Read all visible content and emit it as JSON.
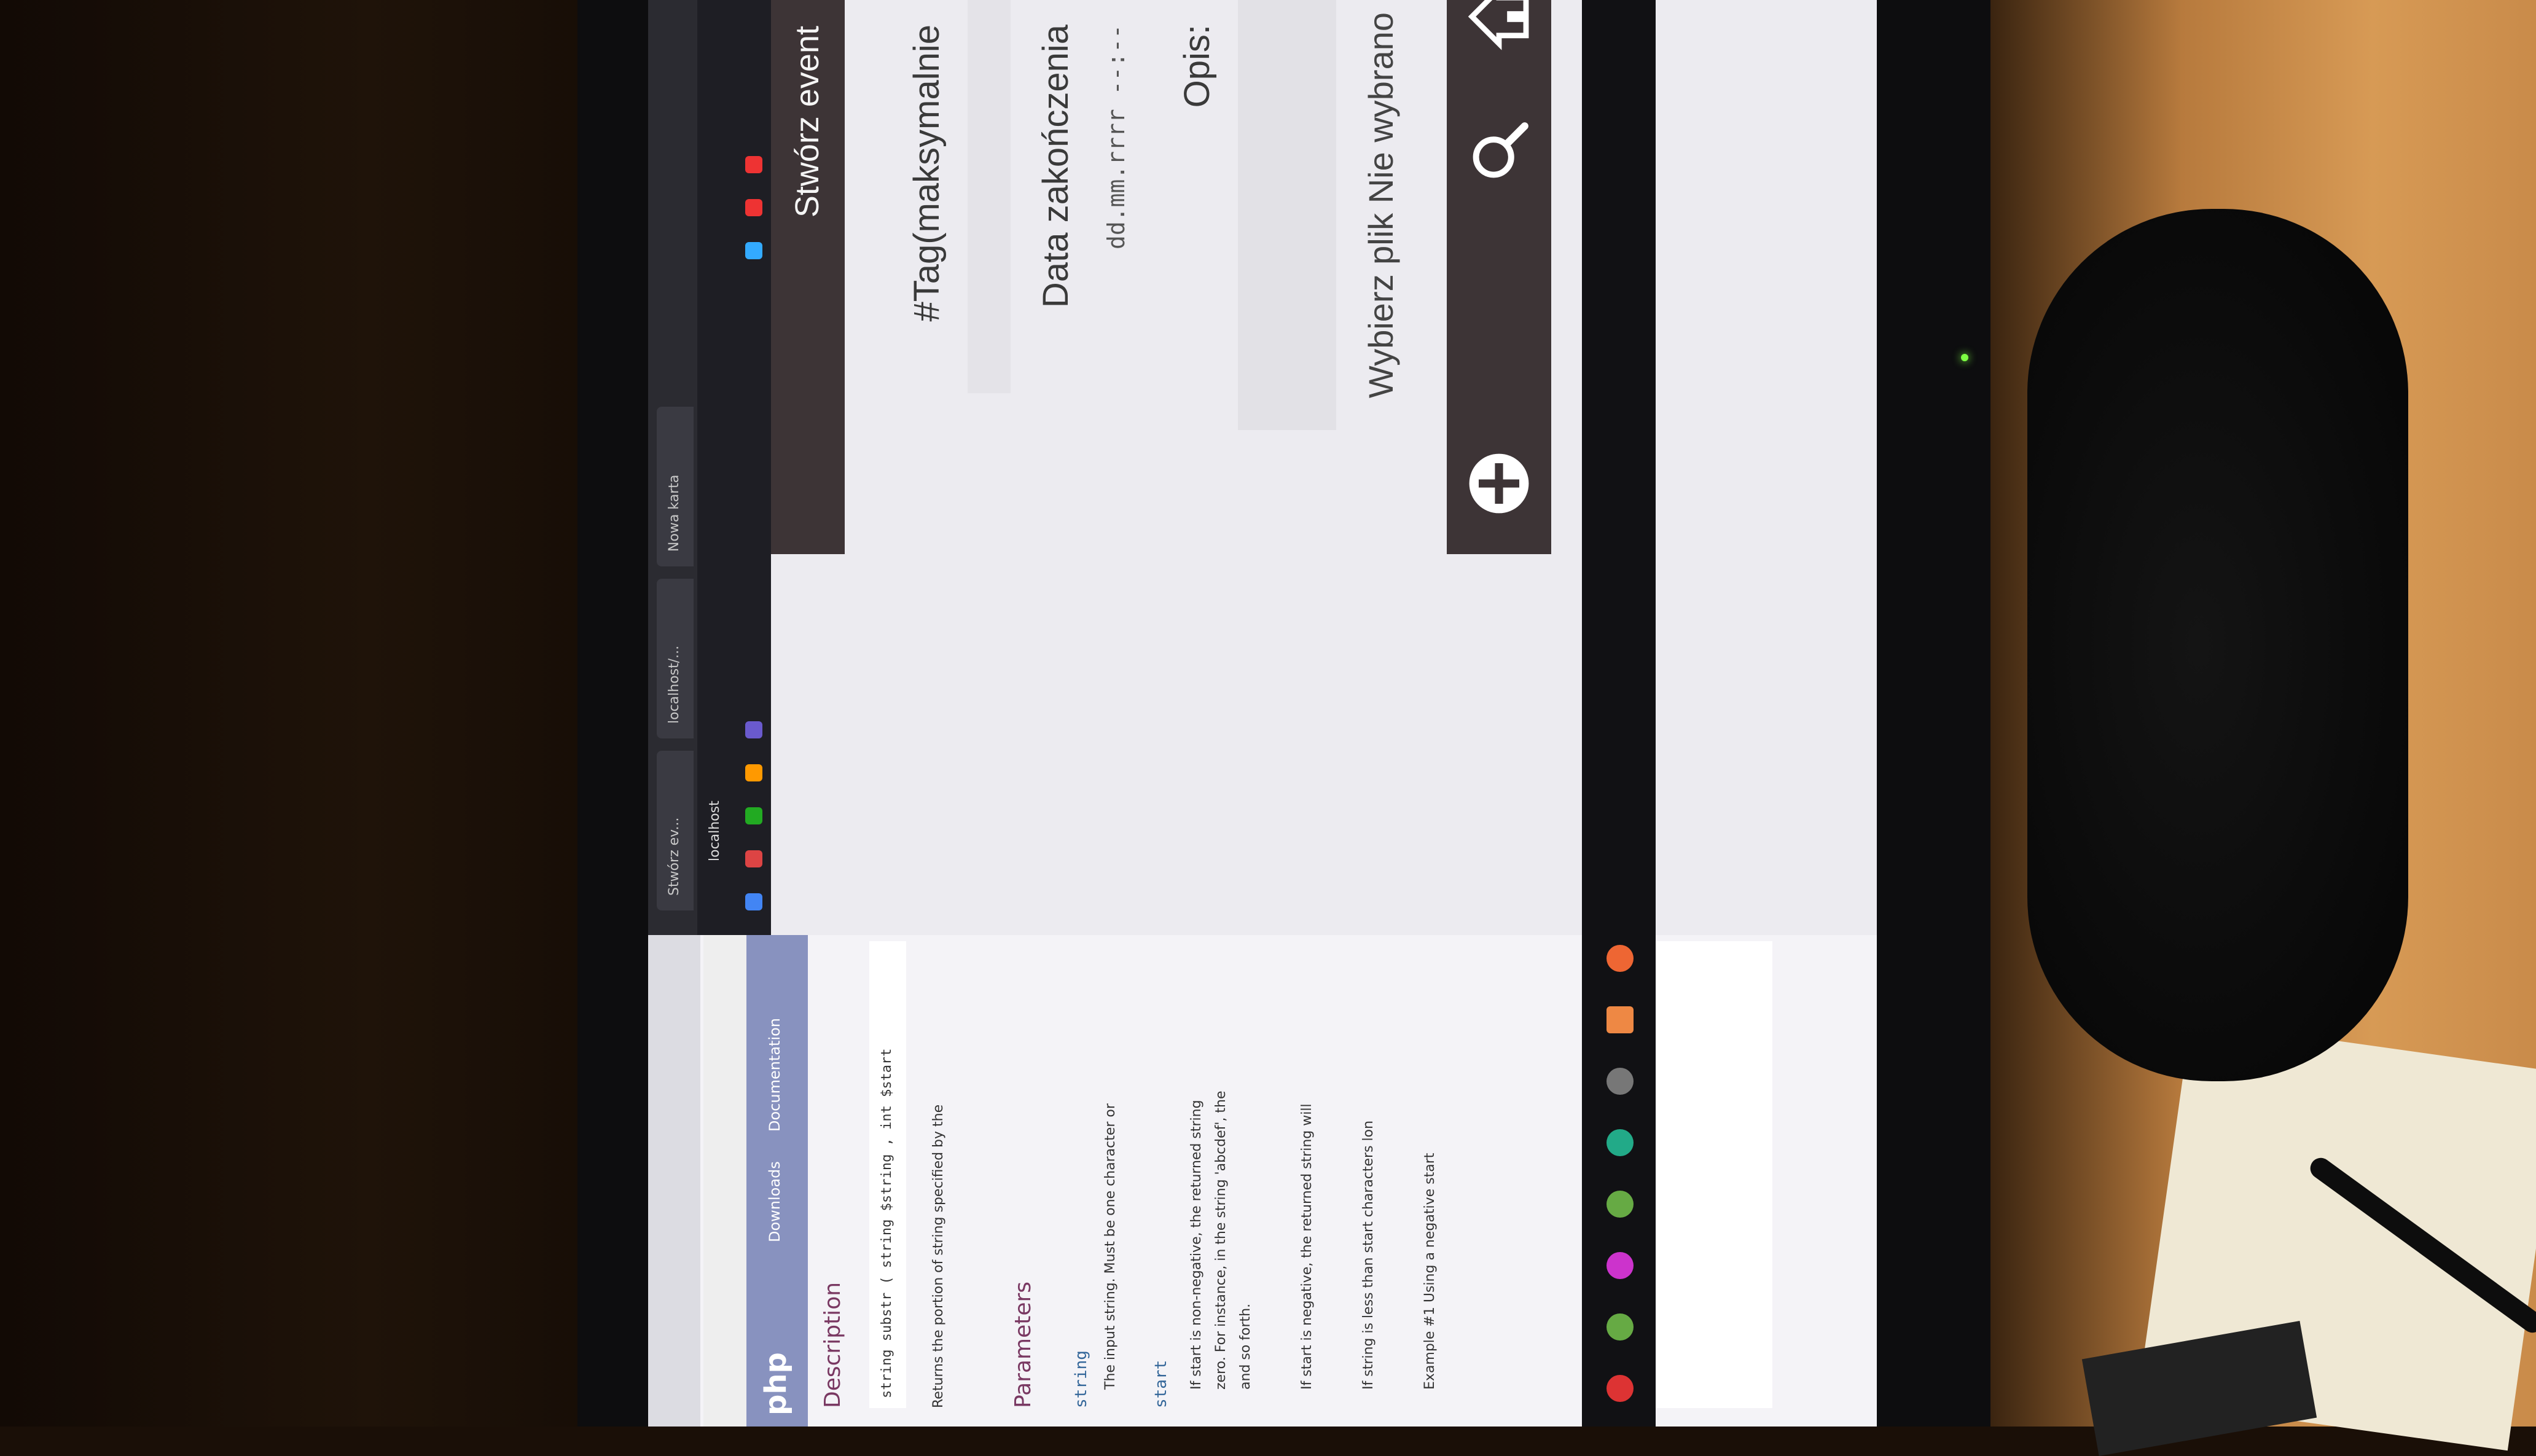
{
  "php_docs": {
    "logo": "php",
    "nav": [
      "Downloads",
      "Documentation"
    ],
    "description_heading": "Description",
    "signature": "string substr ( string $string , int $start",
    "returns": "Returns the portion of string specified by the",
    "parameters_heading": "Parameters",
    "param_string": "string",
    "param_string_desc": "The input string. Must be one character or",
    "param_start": "start",
    "start_desc_1": "If start is non-negative, the returned string",
    "start_desc_2": "zero. For instance, in the string 'abcdef', the",
    "start_desc_3": "and so forth.",
    "start_desc_4": "If start is negative, the returned string will",
    "start_desc_5": "If string is less than start characters lon",
    "example_caption": "Example #1 Using a negative start"
  },
  "browser": {
    "tabs": [
      "Stwórz ev...",
      "localhost/...",
      "Nowa karta"
    ],
    "url": "localhost"
  },
  "form": {
    "title": "Stwórz event",
    "tag_label": "#Tag(maksymalnie",
    "end_date_label": "Data zakończenia",
    "date_placeholder": "dd.mm.rrrr --:--",
    "description_label": "Opis:",
    "file_label": "Wybierz plik Nie wybrano"
  },
  "bottom_nav": {
    "home": "home-icon",
    "search": "search-icon",
    "add": "plus-icon"
  },
  "colors": {
    "header_bg": "#3d3436",
    "php_blue": "#8892bf",
    "form_bg": "#ecebf0"
  }
}
